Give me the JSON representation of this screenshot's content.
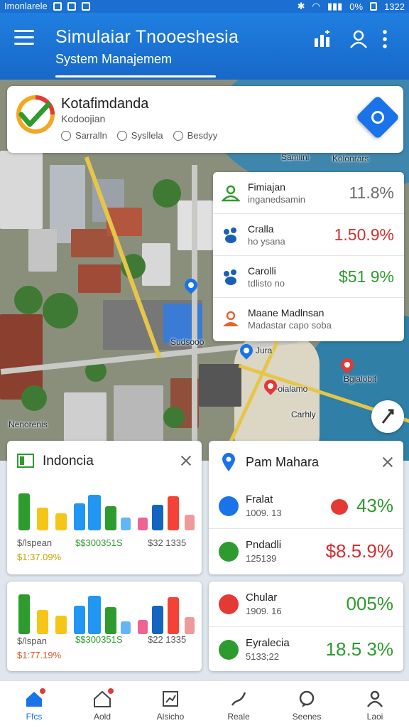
{
  "status_bar": {
    "left_text": "Imonlarele",
    "right_text": "0%",
    "time": "1322"
  },
  "app_bar": {
    "title": "Simulaiar Tnooeshesia",
    "subtitle": "System Manajemem"
  },
  "header_card": {
    "title": "Kotafimdanda",
    "subtitle": "Kodoojian",
    "tags": [
      "Sarralln",
      "Sysllela",
      "Besdyy"
    ]
  },
  "map_labels": [
    "Samiini",
    "Kolonrars",
    "Sudsooo",
    "Jura",
    "Bgialobit",
    "Foialamo",
    "Carhly",
    "Nenorenis"
  ],
  "list_panel": [
    {
      "title": "Fimiajan",
      "subtitle": "inganedsamin",
      "value": "11.8%",
      "color": "#6b6b6b",
      "icon": "people-icon"
    },
    {
      "title": "Cralla",
      "subtitle": "ho ysana",
      "value": "1.50.9%",
      "color": "#d32f2f",
      "icon": "paw-icon"
    },
    {
      "title": "Carolli",
      "subtitle": "tdlisto no",
      "value": "$51 9%",
      "color": "#2e9b2e",
      "icon": "paw-icon"
    },
    {
      "title": "Maane Madlnsan",
      "subtitle": "Madastar capo soba",
      "value": "",
      "color": "#e8622a",
      "icon": "person-icon"
    }
  ],
  "card_indonesia": {
    "title": "Indoncia",
    "footer": [
      {
        "line1": "$/lspean",
        "line2": "$1:37.09%",
        "line2_color": "#c9a200"
      },
      {
        "line1": "$$300351S",
        "line1_color": "#2e9b2e"
      },
      {
        "line1": "$32 1335"
      }
    ]
  },
  "card_second": {
    "footer": [
      {
        "line1": "$/lspan",
        "line2": "$1:77.19%",
        "line2_color": "#e0531f"
      },
      {
        "line1": "$$300351S",
        "line1_color": "#2e9b2e"
      },
      {
        "line1": "$22 1335"
      }
    ]
  },
  "card_pam": {
    "title": "Pam Mahara",
    "rows": [
      {
        "title": "Fralat",
        "subtitle": "1009. 13",
        "value": "43%",
        "color": "#2e9b2e",
        "icon": "leaf-icon"
      },
      {
        "title": "Pndadli",
        "subtitle": "125139",
        "value": "$8.5.9%",
        "color": "#d32f2f",
        "icon": "list-icon"
      }
    ]
  },
  "card_chular": {
    "rows": [
      {
        "title": "Chular",
        "subtitle": "1909. 16",
        "value": "005%",
        "color": "#2e9b2e",
        "icon": "heart-icon"
      },
      {
        "title": "Eyralecia",
        "subtitle": "5133;22",
        "value": "18.5 3%",
        "color": "#2e9b2e",
        "icon": "check-icon"
      }
    ]
  },
  "bottom_nav": [
    {
      "label": "Ffcs",
      "icon": "home-icon",
      "active": true
    },
    {
      "label": "Aold",
      "icon": "house-badge-icon"
    },
    {
      "label": "Alsicho",
      "icon": "chart-icon"
    },
    {
      "label": "Reale",
      "icon": "route-icon"
    },
    {
      "label": "Seenes",
      "icon": "chat-icon"
    },
    {
      "label": "Laoi",
      "icon": "user-icon"
    }
  ],
  "colors": {
    "primary": "#1a73e8",
    "appbar": "#1f7fe0",
    "green": "#2e9b2e",
    "red": "#d32f2f"
  }
}
